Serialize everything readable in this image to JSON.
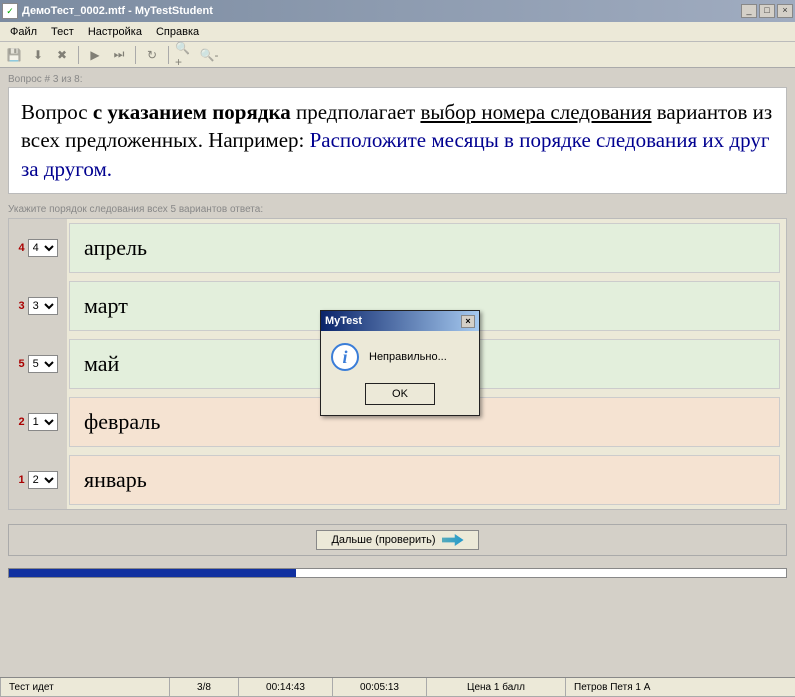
{
  "window": {
    "title": "ДемоТест_0002.mtf - MyTestStudent",
    "minimize": "_",
    "maximize": "□",
    "close": "×"
  },
  "menu": {
    "file": "Файл",
    "test": "Тест",
    "settings": "Настройка",
    "help": "Справка"
  },
  "question_counter": "Вопрос # 3 из 8:",
  "question": {
    "t1": "Вопрос ",
    "t2": "с указанием порядка",
    "t3": " предполагает ",
    "t4": "выбор номера следования",
    "t5": " вариантов из всех предложенных. Например: ",
    "t6": "Расположите месяцы в порядке следования их друг за другом."
  },
  "answers_header": "Укажите порядок следования всех 5 вариантов ответа:",
  "answers": [
    {
      "order": "4",
      "select": "4",
      "text": "апрель",
      "bg": "bg-green"
    },
    {
      "order": "3",
      "select": "3",
      "text": "март",
      "bg": "bg-green"
    },
    {
      "order": "5",
      "select": "5",
      "text": "май",
      "bg": "bg-green"
    },
    {
      "order": "2",
      "select": "1",
      "text": "февраль",
      "bg": "bg-orange"
    },
    {
      "order": "1",
      "select": "2",
      "text": "январь",
      "bg": "bg-orange"
    }
  ],
  "next_button": "Дальше (проверить)",
  "dialog": {
    "title": "MyTest",
    "message": "Неправильно...",
    "ok": "OK",
    "close": "×"
  },
  "status": {
    "state": "Тест идет",
    "progress": "3/8",
    "time1": "00:14:43",
    "time2": "00:05:13",
    "score": "Цена 1 балл",
    "user": "Петров Петя 1 А"
  }
}
